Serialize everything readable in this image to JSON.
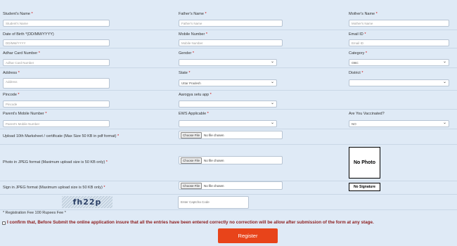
{
  "row1": {
    "student_label": "Student's Name",
    "student_placeholder": "Student's Name",
    "father_label": "Father's Name",
    "father_placeholder": "Father's Name",
    "mother_label": "Mother's Name",
    "mother_placeholder": "Mother's Name"
  },
  "row2": {
    "dob_label": "Date of Birth *(DD/MM/YYYY)",
    "dob_placeholder": "DD/MM/YYYY",
    "mobile_label": "Mobile Number",
    "mobile_placeholder": "Mobile Number",
    "email_label": "Email ID",
    "email_placeholder": "Email ID"
  },
  "row3": {
    "adhar_label": "Adhar Card Number",
    "adhar_placeholder": "Adhar Card Number",
    "gender_label": "Gender",
    "gender_value": "",
    "category_label": "Category",
    "category_value": "OBC"
  },
  "row4": {
    "address_label": "Address",
    "address_placeholder": "Address",
    "state_label": "State",
    "state_value": "Uttar Pradesh",
    "district_label": "District",
    "district_value": ""
  },
  "row5": {
    "pincode_label": "Pincode",
    "pincode_placeholder": "Pincode",
    "aarogya_label": "Aarogya setu app",
    "aarogya_value": ""
  },
  "row6": {
    "parent_mobile_label": "Parent's Mobile Number",
    "parent_mobile_placeholder": "Parent's Mobile Number",
    "ews_label": "EWS Applicable",
    "ews_value": "",
    "vaccinated_label": "Are You Vaccinated?",
    "vaccinated_value": "NO"
  },
  "uploads": {
    "marksheet_label": "Upload 10th Marksheet / certificate (Max Size 50 KB  in pdf format)",
    "photo_label": "Photo in JPEG format (Maximum upload size is 50 KB only)",
    "sign_label": "Sign in JPEG format (Maximum upload size is 50 KB only)",
    "choose_file": "Choose File",
    "no_file": "No file chosen",
    "no_photo": "No Photo",
    "no_signature": "No Signature"
  },
  "captcha": {
    "text": "fh22p",
    "placeholder": "Enter Captcha Code"
  },
  "fee_note": "* Registration Fee 100 Rupees  Fee *",
  "confirm_text": "I confirm that, Before Submit the online application insure that all the entries have been entered correctly no correction will be allow after submission of the form at any stage.",
  "register_label": "Register",
  "colors": {
    "accent": "#e8441a",
    "confirm_text": "#8b1a1a",
    "required": "#cc0000",
    "background": "#dfeaf6"
  }
}
